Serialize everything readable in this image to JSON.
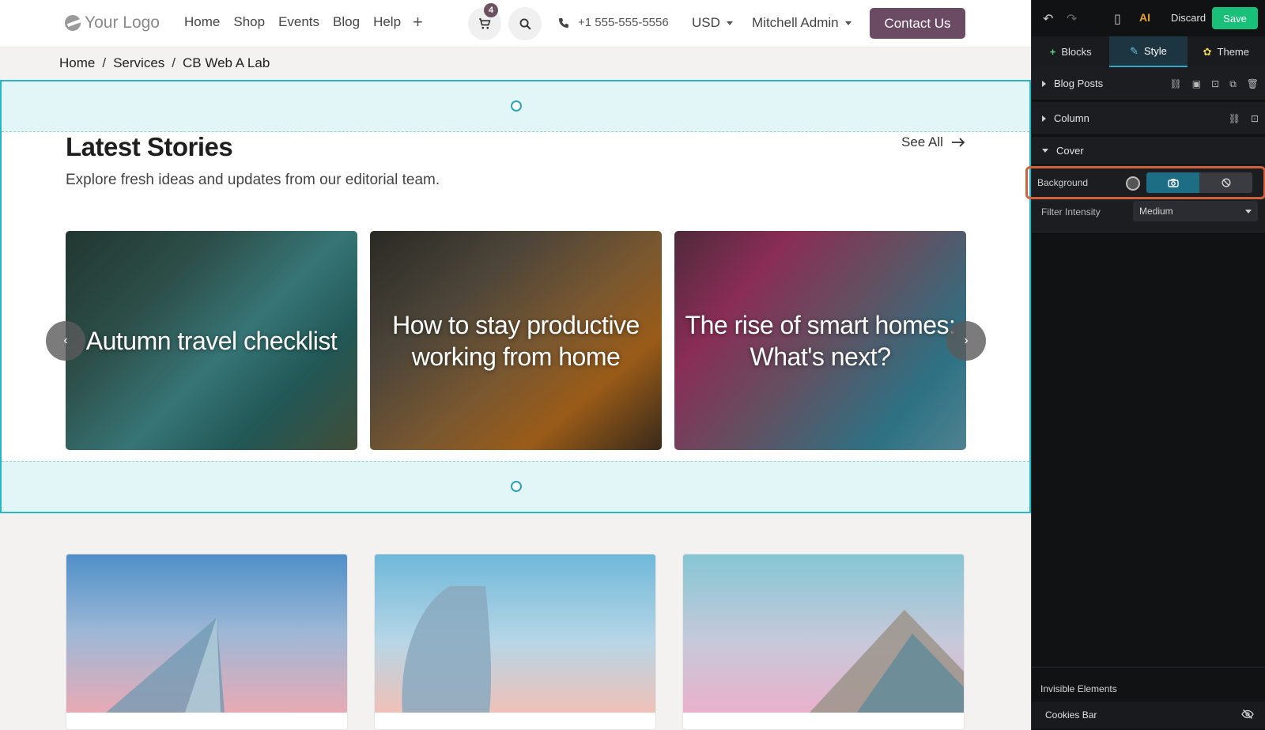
{
  "nav": {
    "logo": "Your Logo",
    "links": [
      "Home",
      "Shop",
      "Events",
      "Blog",
      "Help"
    ],
    "cart_count": "4",
    "phone": "+1 555-555-5556",
    "currency": "USD",
    "user": "Mitchell Admin",
    "contact": "Contact Us"
  },
  "breadcrumb": [
    "Home",
    "Services",
    "CB Web A Lab"
  ],
  "section": {
    "title": "Latest Stories",
    "subtitle": "Explore fresh ideas and updates from our editorial team.",
    "see_all": "See All",
    "stories": [
      "Autumn travel checklist",
      "How to stay productive working from home",
      "The rise of smart homes: What's next?"
    ]
  },
  "editor": {
    "discard": "Discard",
    "save": "Save",
    "tabs": [
      "Blocks",
      "Style",
      "Theme"
    ],
    "active_tab": "Style",
    "rows": [
      "Blog Posts",
      "Column",
      "Cover"
    ],
    "background_label": "Background",
    "filter_label": "Filter Intensity",
    "filter_value": "Medium",
    "invisible_title": "Invisible Elements",
    "invisible_item": "Cookies Bar"
  },
  "colors": {
    "selection": "#28b5c4",
    "contact_button": "#6b4a63",
    "save_button": "#19c07a",
    "highlight": "#d0613d"
  }
}
